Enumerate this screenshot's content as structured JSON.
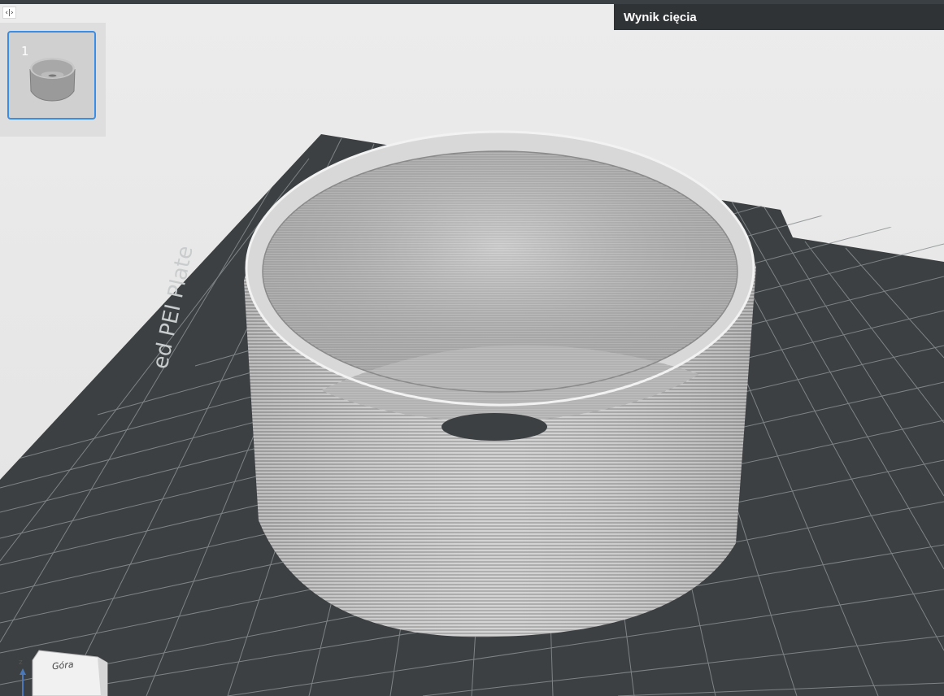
{
  "toolbar": {
    "collapse_glyph": "‹|›"
  },
  "plates": [
    {
      "number": "1",
      "selected": true
    }
  ],
  "result_panel": {
    "title": "Wynik cięcia"
  },
  "bed": {
    "label": "ed PEI Plate"
  },
  "view_cube": {
    "face_label": "Góra",
    "axis_label": "z"
  },
  "colors": {
    "accent": "#3b8ee6",
    "bed": "#3c4042",
    "header_bg": "#2f3336"
  }
}
